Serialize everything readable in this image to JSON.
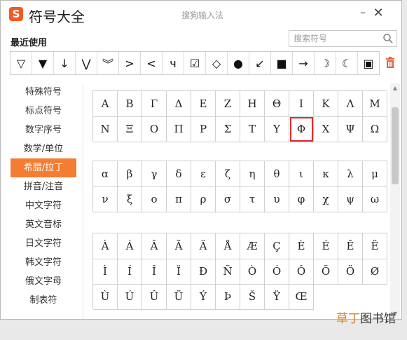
{
  "app": {
    "logo_letter": "S",
    "title": "符号大全",
    "ime_name": "搜狗输入法"
  },
  "recent": {
    "label": "最近使用",
    "symbols": [
      "▽",
      "▼",
      "↓",
      "⋁",
      "︾",
      ">",
      "<",
      "ч",
      "☑",
      "◇",
      "●",
      "↙",
      "■",
      "→",
      "☽",
      "☾",
      "▣"
    ]
  },
  "search": {
    "placeholder": "搜索符号",
    "value": ""
  },
  "sidebar": {
    "items": [
      {
        "label": "特殊符号"
      },
      {
        "label": "标点符号"
      },
      {
        "label": "数字序号"
      },
      {
        "label": "数学/单位"
      },
      {
        "label": "希腊/拉丁",
        "active": true
      },
      {
        "label": "拼音/注音"
      },
      {
        "label": "中文字符"
      },
      {
        "label": "英文音标"
      },
      {
        "label": "日文字符"
      },
      {
        "label": "韩文字符"
      },
      {
        "label": "俄文字母"
      },
      {
        "label": "制表符"
      }
    ]
  },
  "groups": [
    {
      "name": "greek-upper",
      "rows": [
        [
          "Α",
          "Β",
          "Γ",
          "Δ",
          "Ε",
          "Ζ",
          "Η",
          "Θ",
          "Ι",
          "Κ",
          "Λ",
          "Μ"
        ],
        [
          "Ν",
          "Ξ",
          "Ο",
          "Π",
          "Ρ",
          "Σ",
          "Τ",
          "Υ",
          "Φ",
          "Χ",
          "Ψ",
          "Ω"
        ]
      ],
      "selected": [
        1,
        8
      ]
    },
    {
      "name": "greek-lower",
      "rows": [
        [
          "α",
          "β",
          "γ",
          "δ",
          "ε",
          "ζ",
          "η",
          "θ",
          "ι",
          "κ",
          "λ",
          "μ"
        ],
        [
          "ν",
          "ξ",
          "ο",
          "π",
          "ρ",
          "σ",
          "τ",
          "υ",
          "φ",
          "χ",
          "ψ",
          "ω"
        ]
      ]
    },
    {
      "name": "latin-ext",
      "rows": [
        [
          "À",
          "Á",
          "Â",
          "Ã",
          "Ä",
          "Å",
          "Æ",
          "Ç",
          "È",
          "É",
          "Ê",
          "Ë"
        ],
        [
          "Ì",
          "Í",
          "Î",
          "Ï",
          "Ð",
          "Ñ",
          "Ò",
          "Ó",
          "Ô",
          "Õ",
          "Ö",
          "Ø"
        ],
        [
          "Ù",
          "Ú",
          "Û",
          "Ü",
          "Ý",
          "Þ",
          "Š",
          "Ÿ",
          "Œ"
        ]
      ]
    }
  ],
  "watermark": {
    "accent": "草丁",
    "rest": "图书馆"
  },
  "colors": {
    "accent": "#f57c33",
    "selected": "#e02b2b"
  }
}
